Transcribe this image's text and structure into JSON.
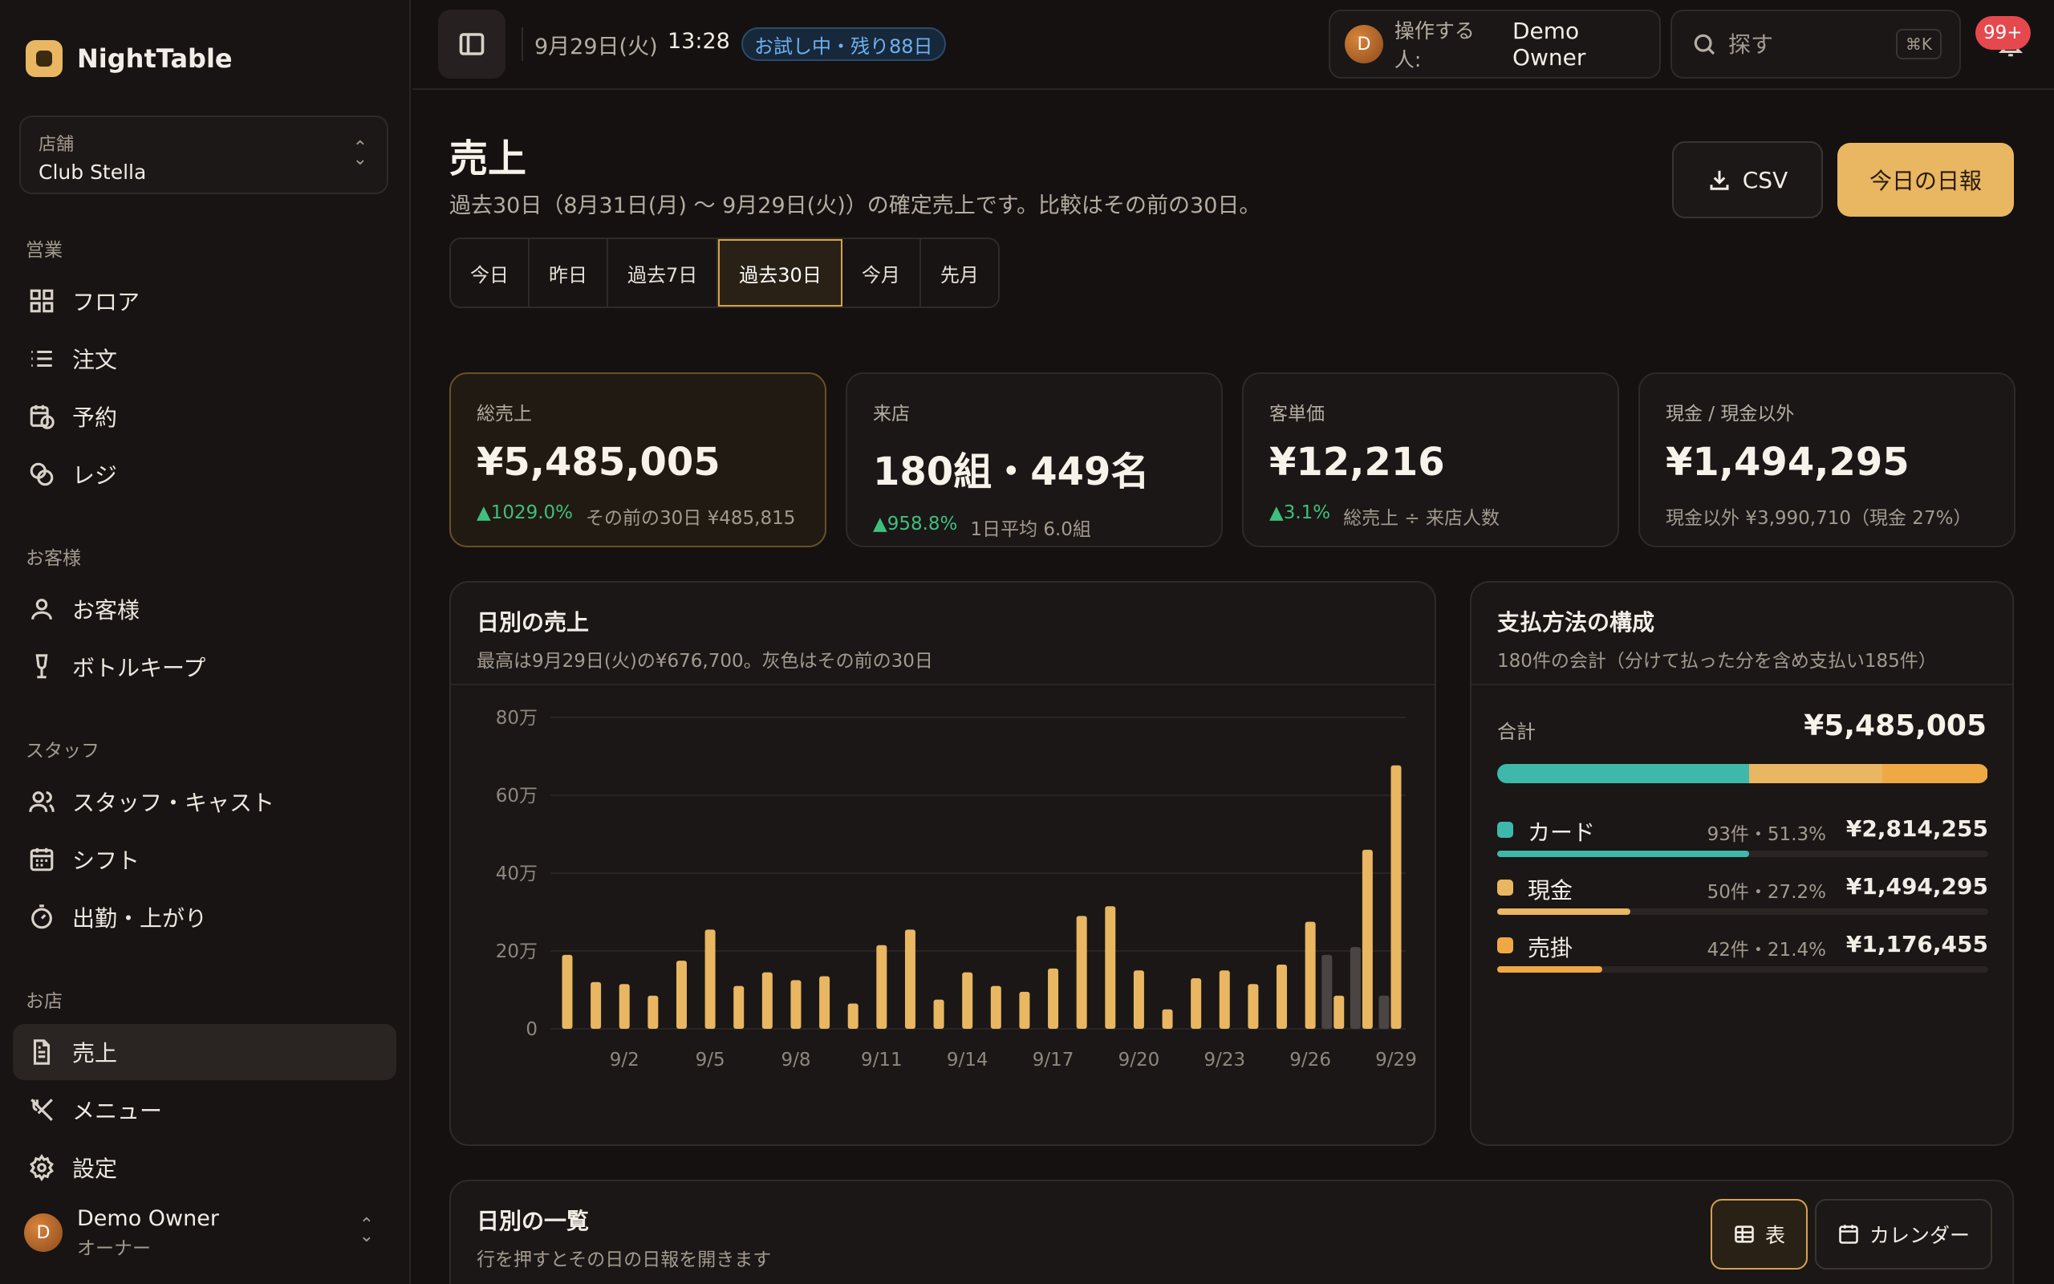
{
  "app": {
    "name": "NightTable"
  },
  "store": {
    "label": "店舗",
    "name": "Club Stella"
  },
  "sidebar": {
    "sections": [
      {
        "title": "営業",
        "items": [
          {
            "label": "フロア",
            "icon": "grid-icon"
          },
          {
            "label": "注文",
            "icon": "list-icon"
          },
          {
            "label": "予約",
            "icon": "calendar-clock-icon"
          },
          {
            "label": "レジ",
            "icon": "coins-icon"
          }
        ]
      },
      {
        "title": "お客様",
        "items": [
          {
            "label": "お客様",
            "icon": "user-icon"
          },
          {
            "label": "ボトルキープ",
            "icon": "wine-icon"
          }
        ]
      },
      {
        "title": "スタッフ",
        "items": [
          {
            "label": "スタッフ・キャスト",
            "icon": "users-icon"
          },
          {
            "label": "シフト",
            "icon": "calendar-icon"
          },
          {
            "label": "出勤・上がり",
            "icon": "timer-icon"
          }
        ]
      },
      {
        "title": "お店",
        "items": [
          {
            "label": "売上",
            "icon": "document-icon",
            "active": true
          },
          {
            "label": "メニュー",
            "icon": "utensils-icon"
          },
          {
            "label": "設定",
            "icon": "gear-icon"
          }
        ]
      }
    ]
  },
  "user": {
    "initial": "D",
    "name": "Demo Owner",
    "role": "オーナー"
  },
  "topbar": {
    "date": "9月29日(火)",
    "time": "13:28",
    "trial": "お試し中・残り88日",
    "operator_label": "操作する人:",
    "operator_name": "Demo Owner",
    "operator_initial": "D",
    "search_placeholder": "探す",
    "search_shortcut": "⌘K",
    "notifications": "99+"
  },
  "page": {
    "title": "売上",
    "subtitle": "過去30日（8月31日(月) 〜 9月29日(火)）の確定売上です。比較はその前の30日。",
    "csv_label": "CSV",
    "report_label": "今日の日報",
    "ranges": [
      "今日",
      "昨日",
      "過去7日",
      "過去30日",
      "今月",
      "先月"
    ],
    "active_range": 3
  },
  "kpis": [
    {
      "label": "総売上",
      "value": "¥5,485,005",
      "delta": "▲1029.0%",
      "note": "その前の30日 ¥485,815"
    },
    {
      "label": "来店",
      "value": "180組・449名",
      "delta": "▲958.8%",
      "note": "1日平均 6.0組"
    },
    {
      "label": "客単価",
      "value": "¥12,216",
      "delta": "▲3.1%",
      "note": "総売上 ÷ 来店人数"
    },
    {
      "label": "現金 / 現金以外",
      "value": "¥1,494,295",
      "delta": "",
      "note": "現金以外 ¥3,990,710（現金 27%）"
    }
  ],
  "daily_chart": {
    "title": "日別の売上",
    "subtitle": "最高は9月29日(火)の¥676,700。灰色はその前の30日"
  },
  "chart_data": {
    "type": "bar",
    "y_ticks": [
      "0",
      "20万",
      "40万",
      "60万",
      "80万"
    ],
    "ylim": [
      0,
      800000
    ],
    "x_tick_labels": [
      "9/2",
      "9/5",
      "9/8",
      "9/11",
      "9/14",
      "9/17",
      "9/20",
      "9/23",
      "9/26",
      "9/29"
    ],
    "x_tick_index": [
      2,
      5,
      8,
      11,
      14,
      17,
      20,
      23,
      26,
      29
    ],
    "categories": [
      "8/31",
      "9/1",
      "9/2",
      "9/3",
      "9/4",
      "9/5",
      "9/6",
      "9/7",
      "9/8",
      "9/9",
      "9/10",
      "9/11",
      "9/12",
      "9/13",
      "9/14",
      "9/15",
      "9/16",
      "9/17",
      "9/18",
      "9/19",
      "9/20",
      "9/21",
      "9/22",
      "9/23",
      "9/24",
      "9/25",
      "9/26",
      "9/27",
      "9/28",
      "9/29"
    ],
    "series": [
      {
        "values": [
          190000,
          120000,
          115000,
          85000,
          175000,
          255000,
          110000,
          145000,
          125000,
          135000,
          65000,
          215000,
          255000,
          75000,
          145000,
          110000,
          95000,
          155000,
          290000,
          315000,
          150000,
          50000,
          130000,
          150000,
          115000,
          165000,
          275000,
          85000,
          460000,
          676700
        ],
        "color": "#e9b662"
      },
      {
        "values": [
          0,
          0,
          0,
          0,
          0,
          0,
          0,
          0,
          0,
          0,
          0,
          0,
          0,
          0,
          0,
          0,
          0,
          0,
          0,
          0,
          0,
          0,
          0,
          0,
          0,
          0,
          0,
          190000,
          210000,
          85000
        ],
        "color": "#4a4542"
      }
    ]
  },
  "payments": {
    "title": "支払方法の構成",
    "subtitle": "180件の会計（分けて払った分を含め支払い185件）",
    "total_label": "合計",
    "total": "¥5,485,005",
    "methods": [
      {
        "name": "カード",
        "meta": "93件・51.3%",
        "amount": "¥2,814,255",
        "share": 0.513,
        "color": "#3fb8ac"
      },
      {
        "name": "現金",
        "meta": "50件・27.2%",
        "amount": "¥1,494,295",
        "share": 0.272,
        "color": "#e9b662"
      },
      {
        "name": "売掛",
        "meta": "42件・21.4%",
        "amount": "¥1,176,455",
        "share": 0.214,
        "color": "#f0a845"
      }
    ]
  },
  "daily_list": {
    "title": "日別の一覧",
    "subtitle": "行を押すとその日の日報を開きます",
    "table_label": "表",
    "calendar_label": "カレンダー"
  }
}
